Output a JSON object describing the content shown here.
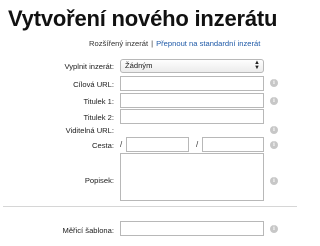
{
  "page": {
    "title": "Vytvoření nového inzerátu"
  },
  "modebar": {
    "current": "Rozšířený inzerát",
    "separator": "|",
    "switch_link": "Přepnout na standardní inzerát"
  },
  "form": {
    "fill_ad": {
      "label": "Vyplnit inzerát:",
      "selected": "Žádným"
    },
    "target_url": {
      "label": "Cílová URL:",
      "value": ""
    },
    "headline1": {
      "label": "Titulek 1:",
      "value": ""
    },
    "headline2": {
      "label": "Titulek 2:",
      "value": ""
    },
    "display_url": {
      "label": "Viditelná URL:"
    },
    "path": {
      "label": "Cesta:",
      "slash1": "/",
      "slash2": "/",
      "value1": "",
      "value2": ""
    },
    "description": {
      "label": "Popisek:",
      "value": ""
    },
    "tracking_template": {
      "label": "Měřicí šablona:",
      "value": ""
    }
  },
  "icons": {
    "info": "info-icon",
    "info_glyph": "i",
    "select_arrows": "▲▼"
  }
}
